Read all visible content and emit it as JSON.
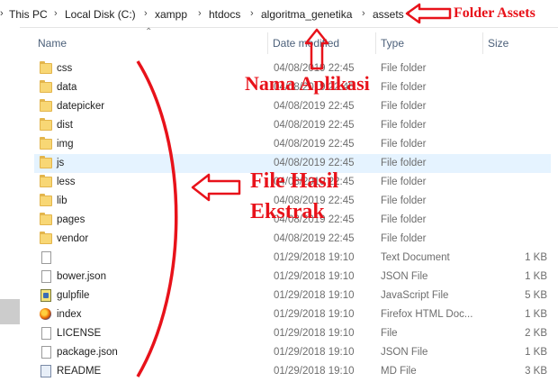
{
  "breadcrumb": {
    "items": [
      "This PC",
      "Local Disk (C:)",
      "xampp",
      "htdocs",
      "algoritma_genetika",
      "assets"
    ]
  },
  "columns": {
    "name": "Name",
    "date": "Date modified",
    "type": "Type",
    "size": "Size"
  },
  "files": [
    {
      "name": "css",
      "date": "04/08/2019 22:45",
      "type": "File folder",
      "size": "",
      "icon": "folder-icon"
    },
    {
      "name": "data",
      "date": "04/08/2019 22:45",
      "type": "File folder",
      "size": "",
      "icon": "folder-icon"
    },
    {
      "name": "datepicker",
      "date": "04/08/2019 22:45",
      "type": "File folder",
      "size": "",
      "icon": "folder-icon"
    },
    {
      "name": "dist",
      "date": "04/08/2019 22:45",
      "type": "File folder",
      "size": "",
      "icon": "folder-icon"
    },
    {
      "name": "img",
      "date": "04/08/2019 22:45",
      "type": "File folder",
      "size": "",
      "icon": "folder-icon"
    },
    {
      "name": "js",
      "date": "04/08/2019 22:45",
      "type": "File folder",
      "size": "",
      "icon": "folder-icon",
      "selected": true
    },
    {
      "name": "less",
      "date": "04/08/2019 22:45",
      "type": "File folder",
      "size": "",
      "icon": "folder-icon"
    },
    {
      "name": "lib",
      "date": "04/08/2019 22:45",
      "type": "File folder",
      "size": "",
      "icon": "folder-icon"
    },
    {
      "name": "pages",
      "date": "04/08/2019 22:45",
      "type": "File folder",
      "size": "",
      "icon": "folder-icon"
    },
    {
      "name": "vendor",
      "date": "04/08/2019 22:45",
      "type": "File folder",
      "size": "",
      "icon": "folder-icon"
    },
    {
      "name": "",
      "date": "01/29/2018 19:10",
      "type": "Text Document",
      "size": "1 KB",
      "icon": "file-icon"
    },
    {
      "name": "bower.json",
      "date": "01/29/2018 19:10",
      "type": "JSON File",
      "size": "1 KB",
      "icon": "file-icon"
    },
    {
      "name": "gulpfile",
      "date": "01/29/2018 19:10",
      "type": "JavaScript File",
      "size": "5 KB",
      "icon": "js-icon"
    },
    {
      "name": "index",
      "date": "01/29/2018 19:10",
      "type": "Firefox HTML Doc...",
      "size": "1 KB",
      "icon": "ff-icon"
    },
    {
      "name": "LICENSE",
      "date": "01/29/2018 19:10",
      "type": "File",
      "size": "2 KB",
      "icon": "file-icon"
    },
    {
      "name": "package.json",
      "date": "01/29/2018 19:10",
      "type": "JSON File",
      "size": "1 KB",
      "icon": "file-icon"
    },
    {
      "name": "README",
      "date": "01/29/2018 19:10",
      "type": "MD File",
      "size": "3 KB",
      "icon": "md-icon"
    }
  ],
  "annotations": {
    "folder_assets": "Folder Assets",
    "nama_aplikasi": "Nama Aplikasi",
    "file_hasil_line1": "File Hasil",
    "file_hasil_line2": "Ekstrak"
  },
  "colors": {
    "annotation": "#e8121a",
    "selection": "#e5f3ff",
    "header_text": "#4c607a"
  }
}
